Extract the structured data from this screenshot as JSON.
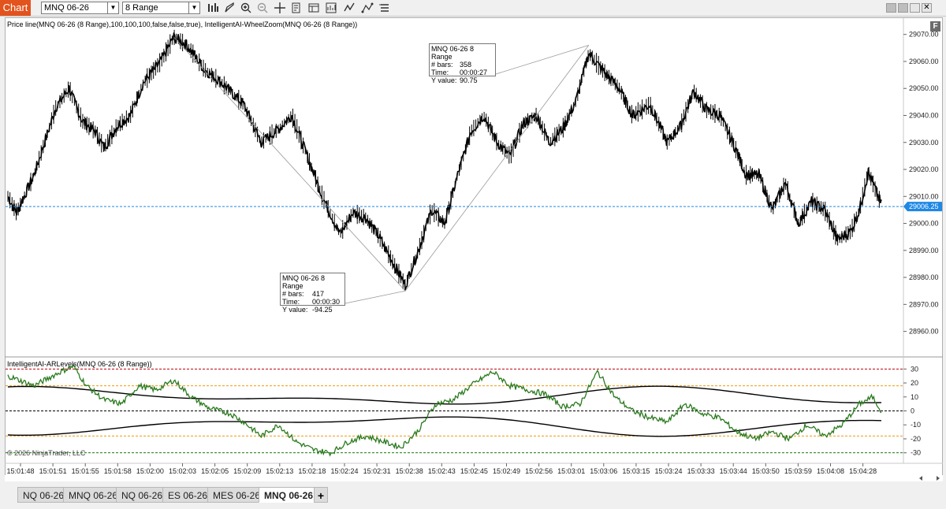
{
  "toolbar": {
    "app_label": "Chart",
    "instrument": "MNQ 06-26",
    "period": "8 Range"
  },
  "icons": [
    "bars-icon",
    "pencil-icon",
    "zoom-in-icon",
    "zoom-out-icon",
    "crosshair-icon",
    "properties-icon",
    "data-box-icon",
    "strategies-icon",
    "indicators-icon",
    "drawing-tools-icon",
    "templates-icon"
  ],
  "price_panel": {
    "indicator_text": "Price line(MNQ 06-26 (8 Range),100,100,100,false,false,true), IntelligentAI-WheelZoom(MNQ 06-26 (8 Range))",
    "f_label": "F",
    "current_price": "29006.25",
    "axis_labels": [
      "29070.00",
      "29060.00",
      "29050.00",
      "29040.00",
      "29030.00",
      "29020.00",
      "29010.00",
      "29000.00",
      "28990.00",
      "28980.00",
      "28970.00",
      "28960.00"
    ],
    "info_boxes": [
      {
        "title": "MNQ 06-26 8 Range",
        "bars_label": "# bars:",
        "bars": "417",
        "time_label": "Time:",
        "time": "00:00:30",
        "yval_label": "Y value:",
        "yval": "-94.25"
      },
      {
        "title": "MNQ 06-26 8 Range",
        "bars_label": "# bars:",
        "bars": "358",
        "time_label": "Time:",
        "time": "00:00:27",
        "yval_label": "Y value:",
        "yval": "90.75"
      }
    ]
  },
  "lower_panel": {
    "indicator_text": "IntelligentAI-ARLevels(MNQ 06-26 (8 Range))",
    "axis_labels": [
      "30",
      "20",
      "10",
      "0",
      "-10",
      "-20",
      "-30"
    ],
    "copyright": "© 2026 NinjaTrader, LLC"
  },
  "time_axis": [
    "15:01:48",
    "15:01:51",
    "15:01:55",
    "15:01:58",
    "15:02:00",
    "15:02:03",
    "15:02:05",
    "15:02:09",
    "15:02:13",
    "15:02:18",
    "15:02:24",
    "15:02:31",
    "15:02:38",
    "15:02:43",
    "15:02:45",
    "15:02:49",
    "15:02:56",
    "15:03:01",
    "15:03:06",
    "15:03:15",
    "15:03:24",
    "15:03:33",
    "15:03:44",
    "15:03:50",
    "15:03:59",
    "15:04:08",
    "15:04:28"
  ],
  "tabs": [
    {
      "label": "NQ 06-26",
      "active": false
    },
    {
      "label": "MNQ 06-26",
      "active": false
    },
    {
      "label": "NQ 06-26",
      "active": false
    },
    {
      "label": "ES 06-26",
      "active": false
    },
    {
      "label": "MES 06-26",
      "active": false
    },
    {
      "label": "MNQ 06-26",
      "active": true
    }
  ],
  "tab_add_label": "+",
  "chart_data": {
    "type": "line",
    "price_anchors": [
      {
        "t": 0,
        "p": 29010
      },
      {
        "t": 0.01,
        "p": 29004
      },
      {
        "t": 0.03,
        "p": 29018
      },
      {
        "t": 0.055,
        "p": 29043
      },
      {
        "t": 0.07,
        "p": 29050
      },
      {
        "t": 0.085,
        "p": 29038
      },
      {
        "t": 0.1,
        "p": 29034
      },
      {
        "t": 0.11,
        "p": 29028
      },
      {
        "t": 0.125,
        "p": 29036
      },
      {
        "t": 0.14,
        "p": 29040
      },
      {
        "t": 0.155,
        "p": 29052
      },
      {
        "t": 0.175,
        "p": 29060
      },
      {
        "t": 0.19,
        "p": 29069
      },
      {
        "t": 0.205,
        "p": 29066
      },
      {
        "t": 0.225,
        "p": 29057
      },
      {
        "t": 0.245,
        "p": 29052
      },
      {
        "t": 0.27,
        "p": 29044
      },
      {
        "t": 0.29,
        "p": 29030
      },
      {
        "t": 0.31,
        "p": 29035
      },
      {
        "t": 0.325,
        "p": 29040
      },
      {
        "t": 0.345,
        "p": 29023
      },
      {
        "t": 0.36,
        "p": 29010
      },
      {
        "t": 0.38,
        "p": 28996
      },
      {
        "t": 0.395,
        "p": 29004
      },
      {
        "t": 0.41,
        "p": 29002
      },
      {
        "t": 0.425,
        "p": 28995
      },
      {
        "t": 0.445,
        "p": 28983
      },
      {
        "t": 0.455,
        "p": 28977
      },
      {
        "t": 0.47,
        "p": 28990
      },
      {
        "t": 0.485,
        "p": 29005
      },
      {
        "t": 0.5,
        "p": 29000
      },
      {
        "t": 0.515,
        "p": 29018
      },
      {
        "t": 0.53,
        "p": 29034
      },
      {
        "t": 0.545,
        "p": 29040
      },
      {
        "t": 0.56,
        "p": 29030
      },
      {
        "t": 0.575,
        "p": 29025
      },
      {
        "t": 0.59,
        "p": 29037
      },
      {
        "t": 0.605,
        "p": 29040
      },
      {
        "t": 0.62,
        "p": 29030
      },
      {
        "t": 0.635,
        "p": 29035
      },
      {
        "t": 0.65,
        "p": 29045
      },
      {
        "t": 0.665,
        "p": 29063
      },
      {
        "t": 0.68,
        "p": 29057
      },
      {
        "t": 0.7,
        "p": 29050
      },
      {
        "t": 0.715,
        "p": 29040
      },
      {
        "t": 0.735,
        "p": 29044
      },
      {
        "t": 0.755,
        "p": 29030
      },
      {
        "t": 0.77,
        "p": 29036
      },
      {
        "t": 0.785,
        "p": 29049
      },
      {
        "t": 0.8,
        "p": 29042
      },
      {
        "t": 0.815,
        "p": 29040
      },
      {
        "t": 0.83,
        "p": 29030
      },
      {
        "t": 0.845,
        "p": 29018
      },
      {
        "t": 0.86,
        "p": 29018
      },
      {
        "t": 0.875,
        "p": 29005
      },
      {
        "t": 0.89,
        "p": 29015
      },
      {
        "t": 0.905,
        "p": 29000
      },
      {
        "t": 0.92,
        "p": 29008
      },
      {
        "t": 0.935,
        "p": 29005
      },
      {
        "t": 0.95,
        "p": 28994
      },
      {
        "t": 0.965,
        "p": 28997
      },
      {
        "t": 0.975,
        "p": 29005
      },
      {
        "t": 0.985,
        "p": 29019
      },
      {
        "t": 1,
        "p": 29007
      }
    ],
    "zigzag": [
      {
        "t": 0.19,
        "p": 29069
      },
      {
        "t": 0.455,
        "p": 28975
      },
      {
        "t": 0.665,
        "p": 29066
      }
    ],
    "price_ylim": [
      28952,
      29074
    ],
    "osc_anchors": [
      {
        "t": 0,
        "v": 25
      },
      {
        "t": 0.03,
        "v": 18
      },
      {
        "t": 0.06,
        "v": 28
      },
      {
        "t": 0.075,
        "v": 32
      },
      {
        "t": 0.09,
        "v": 18
      },
      {
        "t": 0.11,
        "v": 8
      },
      {
        "t": 0.13,
        "v": 5
      },
      {
        "t": 0.15,
        "v": 18
      },
      {
        "t": 0.17,
        "v": 15
      },
      {
        "t": 0.19,
        "v": 22
      },
      {
        "t": 0.21,
        "v": 10
      },
      {
        "t": 0.23,
        "v": 2
      },
      {
        "t": 0.255,
        "v": -2
      },
      {
        "t": 0.27,
        "v": -8
      },
      {
        "t": 0.29,
        "v": -18
      },
      {
        "t": 0.31,
        "v": -10
      },
      {
        "t": 0.33,
        "v": -22
      },
      {
        "t": 0.35,
        "v": -28
      },
      {
        "t": 0.37,
        "v": -30
      },
      {
        "t": 0.39,
        "v": -22
      },
      {
        "t": 0.41,
        "v": -18
      },
      {
        "t": 0.43,
        "v": -22
      },
      {
        "t": 0.45,
        "v": -26
      },
      {
        "t": 0.47,
        "v": -14
      },
      {
        "t": 0.49,
        "v": 5
      },
      {
        "t": 0.51,
        "v": 8
      },
      {
        "t": 0.53,
        "v": 18
      },
      {
        "t": 0.555,
        "v": 28
      },
      {
        "t": 0.575,
        "v": 18
      },
      {
        "t": 0.595,
        "v": 15
      },
      {
        "t": 0.615,
        "v": 12
      },
      {
        "t": 0.635,
        "v": 3
      },
      {
        "t": 0.655,
        "v": 5
      },
      {
        "t": 0.675,
        "v": 28
      },
      {
        "t": 0.695,
        "v": 10
      },
      {
        "t": 0.715,
        "v": 0
      },
      {
        "t": 0.735,
        "v": -5
      },
      {
        "t": 0.755,
        "v": -8
      },
      {
        "t": 0.775,
        "v": 5
      },
      {
        "t": 0.795,
        "v": -2
      },
      {
        "t": 0.815,
        "v": -5
      },
      {
        "t": 0.835,
        "v": -15
      },
      {
        "t": 0.855,
        "v": -20
      },
      {
        "t": 0.875,
        "v": -15
      },
      {
        "t": 0.895,
        "v": -20
      },
      {
        "t": 0.915,
        "v": -10
      },
      {
        "t": 0.935,
        "v": -18
      },
      {
        "t": 0.955,
        "v": -10
      },
      {
        "t": 0.975,
        "v": 5
      },
      {
        "t": 0.99,
        "v": 10
      },
      {
        "t": 1,
        "v": 0
      }
    ],
    "osc_ylim": [
      -33,
      33
    ],
    "levels": [
      {
        "v": 30,
        "color": "#c0000a"
      },
      {
        "v": 18,
        "color": "#f09a12"
      },
      {
        "v": 0,
        "color": "#000000"
      },
      {
        "v": -18,
        "color": "#f09a12"
      },
      {
        "v": -30,
        "color": "#1a7a10"
      }
    ],
    "colors": {
      "candle": "#000000",
      "osc": "#2a7a1e",
      "price_line": "#1e88e5",
      "zigzag": "#999999"
    }
  }
}
